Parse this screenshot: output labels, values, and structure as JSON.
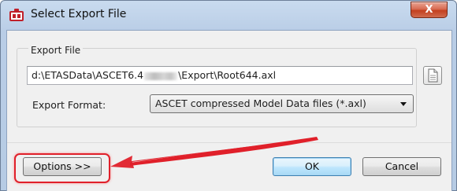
{
  "window": {
    "title": "Select Export File",
    "close_label": "X"
  },
  "export_file": {
    "group_label": "Export File",
    "path_prefix": "d:\\ETASData\\ASCET6.4",
    "path_suffix": "\\Export\\Root644.axl",
    "browse_icon": "document-icon"
  },
  "export_format": {
    "label": "Export Format:",
    "selected": "ASCET compressed Model Data files (*.axl)"
  },
  "buttons": {
    "options": "Options >>",
    "ok": "OK",
    "cancel": "Cancel"
  },
  "annotation": {
    "color": "#e0202a"
  }
}
